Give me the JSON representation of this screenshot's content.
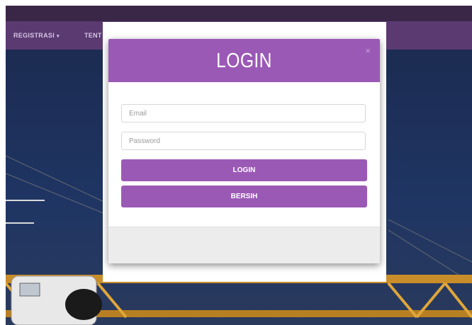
{
  "nav": {
    "items": [
      {
        "label": "REGISTRASI",
        "caret": "▾"
      },
      {
        "label": "TENT"
      }
    ]
  },
  "modal": {
    "title": "LOGIN",
    "close_symbol": "×",
    "email_placeholder": "Email",
    "password_placeholder": "Password",
    "login_label": "LOGIN",
    "clear_label": "BERSIH"
  },
  "colors": {
    "accent": "#9b59b6",
    "navbar": "#5b3a72",
    "topbar": "#3a2647",
    "sky": "#1f3563",
    "crane": "#e0a63a"
  },
  "icons": {
    "close": "close-icon",
    "dropdown": "caret-down-icon"
  }
}
